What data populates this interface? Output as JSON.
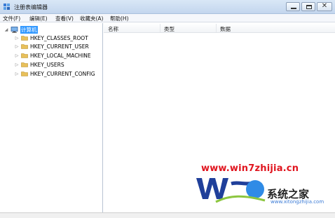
{
  "window": {
    "title": "注册表编辑器",
    "icon": "registry-editor-icon",
    "buttons": {
      "minimize": "minimize",
      "maximize": "maximize",
      "close": "✕"
    }
  },
  "menu": {
    "items": [
      "文件(F)",
      "编辑(E)",
      "查看(V)",
      "收藏夹(A)",
      "帮助(H)"
    ]
  },
  "tree": {
    "root": {
      "label": "计算机",
      "icon": "computer-icon",
      "expanded": true,
      "selected": true
    },
    "children": [
      {
        "label": "HKEY_CLASSES_ROOT",
        "icon": "folder-icon"
      },
      {
        "label": "HKEY_CURRENT_USER",
        "icon": "folder-icon"
      },
      {
        "label": "HKEY_LOCAL_MACHINE",
        "icon": "folder-icon"
      },
      {
        "label": "HKEY_USERS",
        "icon": "folder-icon"
      },
      {
        "label": "HKEY_CURRENT_CONFIG",
        "icon": "folder-icon"
      }
    ]
  },
  "list": {
    "columns": [
      "名称",
      "类型",
      "数据"
    ]
  },
  "watermark": {
    "url": "www.win7zhijia.cn",
    "brand": "系统之家",
    "site": "www.xitongzhijia.com",
    "colors": {
      "url": "#e0141e",
      "logo_blue": "#1f3f9a",
      "logo_orb": "#2f8be6",
      "swoosh": "#8cc63f"
    }
  },
  "colors": {
    "titlebar": "#c3d6ee",
    "selection": "#3399ff",
    "folder": "#e8c05a"
  }
}
